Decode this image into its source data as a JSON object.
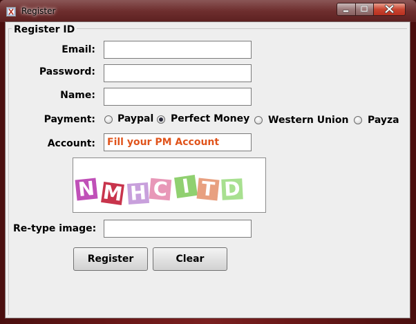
{
  "window": {
    "title": "Register"
  },
  "form": {
    "group_title": "Register ID",
    "email_label": "Email:",
    "email_value": "",
    "password_label": "Password:",
    "password_value": "",
    "name_label": "Name:",
    "name_value": "",
    "payment_label": "Payment:",
    "payment_options": [
      {
        "label": "Paypal",
        "selected": false
      },
      {
        "label": "Perfect Money",
        "selected": true
      },
      {
        "label": "Western Union",
        "selected": false
      },
      {
        "label": "Payza",
        "selected": false
      }
    ],
    "account_label": "Account:",
    "account_value": "Fill your PM Account",
    "account_color": "#e0541c",
    "captcha_text": "NMHCITD",
    "captcha_colors": [
      "#c050b8",
      "#c8344c",
      "#c8a0dc",
      "#e898b8",
      "#90d070",
      "#e8a080",
      "#a8e090"
    ],
    "retype_label": "Re-type image:",
    "retype_value": ""
  },
  "buttons": {
    "register": "Register",
    "clear": "Clear"
  }
}
